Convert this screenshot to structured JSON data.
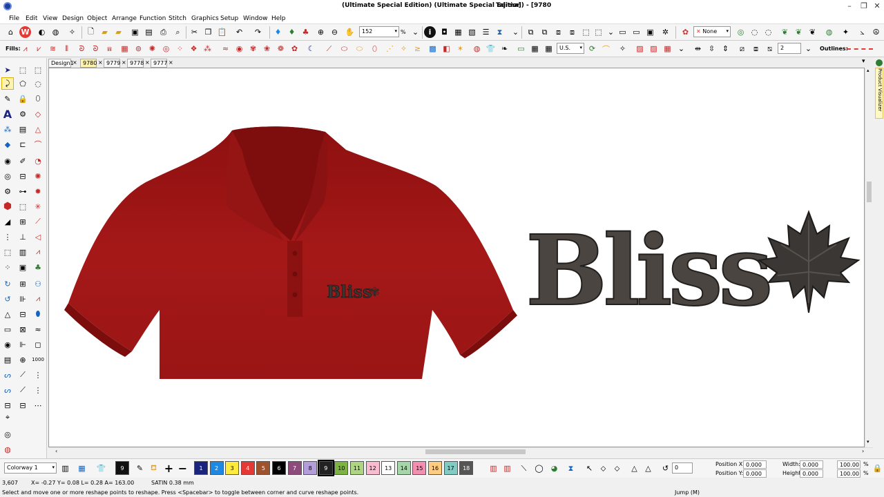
{
  "window": {
    "title": "(Ultimate Special Edition) (Ultimate Special Edition) - [9780",
    "title_right": "Tajima]",
    "minimize": "–",
    "restore": "❐",
    "close": "✕"
  },
  "menu": {
    "items": [
      "File",
      "Edit",
      "View",
      "Design",
      "Object",
      "Arrange",
      "Function",
      "Stitch",
      "Graphics",
      "Setup",
      "Window",
      "Help"
    ]
  },
  "toolbar1": {
    "zoom_value": "152",
    "zoom_unit": "%",
    "none_combo": "None"
  },
  "toolbar2": {
    "fills_label": "Fills:",
    "units_combo": "U.S.",
    "spin_value": "2",
    "outlines_label": "Outlines:"
  },
  "tabs": [
    "Design1",
    "9780",
    "9779",
    "9778",
    "9777"
  ],
  "right_panel": {
    "label": "Product Visualizer"
  },
  "design": {
    "word": "Bliss",
    "shirt_color": "#9c1414",
    "thread_color": "#4a4541"
  },
  "bottom": {
    "colorway": "Colorway 1",
    "current_color": "9",
    "swatches": [
      {
        "n": "1",
        "c": "#1a237e"
      },
      {
        "n": "2",
        "c": "#1e88e5"
      },
      {
        "n": "3",
        "c": "#ffeb3b"
      },
      {
        "n": "4",
        "c": "#e53935"
      },
      {
        "n": "5",
        "c": "#a0522d"
      },
      {
        "n": "6",
        "c": "#000000"
      },
      {
        "n": "7",
        "c": "#8e4a7a"
      },
      {
        "n": "8",
        "c": "#b39ddb"
      },
      {
        "n": "9",
        "c": "#222222"
      },
      {
        "n": "10",
        "c": "#7cb342"
      },
      {
        "n": "11",
        "c": "#aed581"
      },
      {
        "n": "12",
        "c": "#f8bbd0"
      },
      {
        "n": "13",
        "c": "#ffffff"
      },
      {
        "n": "14",
        "c": "#a5d6a7"
      },
      {
        "n": "15",
        "c": "#f48fb1"
      },
      {
        "n": "16",
        "c": "#ffcc80"
      },
      {
        "n": "17",
        "c": "#80cbc4"
      },
      {
        "n": "18",
        "c": "#555555"
      }
    ],
    "undo_count": "0",
    "position_x_label": "Position X:",
    "position_y_label": "Position Y:",
    "position_x": "0.000",
    "position_y": "0.000",
    "width_label": "Width:",
    "height_label": "Height:",
    "width": "0.000",
    "height": "0.000",
    "width_pct": "100.00",
    "height_pct": "100.00"
  },
  "status": {
    "stitch_count": "3,607",
    "coords": "X=  -0.27 Y=   0.08 L=   0.28 A= 163.00",
    "stitch_info": "SATIN  0.38 mm",
    "hint": "Select and move one or more reshape points to reshape. Press <Spacebar> to toggle between corner and curve reshape points.",
    "mode": "Jump (M)"
  }
}
